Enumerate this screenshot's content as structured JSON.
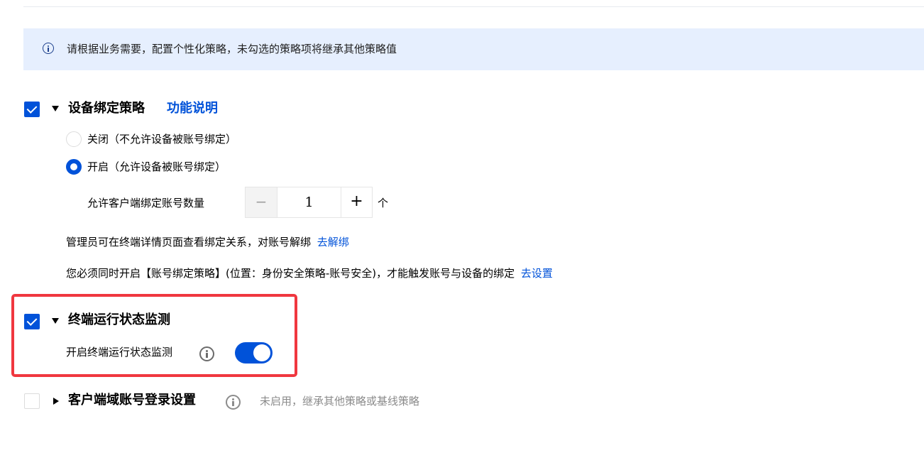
{
  "banner": {
    "icon": "info-outline-icon",
    "text": "请根据业务需要，配置个性化策略，未勾选的策略项将继承其他策略值"
  },
  "device_binding": {
    "checked": true,
    "title": "设备绑定策略",
    "help_link": "功能说明",
    "option_off_label": "关闭（不允许设备被账号绑定）",
    "option_on_label": "开启（允许设备被账号绑定）",
    "selected": "on",
    "count_label": "允许客户端绑定账号数量",
    "stepper": {
      "minus": "−",
      "value": "1",
      "plus": "+"
    },
    "count_unit": "个",
    "admin_note": "管理员可在终端详情页面查看绑定关系，对账号解绑",
    "unbind_link": "去解绑",
    "require_note": "您必须同时开启【账号绑定策略】(位置：身份安全策略-账号安全)，才能触发账号与设备的绑定",
    "settings_link": "去设置"
  },
  "terminal_monitor": {
    "checked": true,
    "title": "终端运行状态监测",
    "toggle_label": "开启终端运行状态监测",
    "toggle_on": true
  },
  "domain_login": {
    "checked": false,
    "title": "客户端域账号登录设置",
    "status": "未启用，继承其他策略或基线策略"
  },
  "colors": {
    "primary": "#0052d9",
    "banner_bg": "#e6effe",
    "highlight": "#f0373f"
  }
}
